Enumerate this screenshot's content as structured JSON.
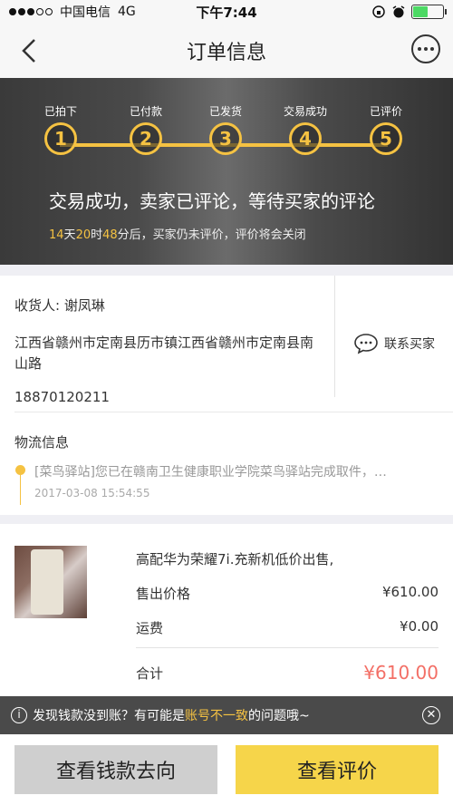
{
  "status_bar": {
    "carrier": "中国电信",
    "network": "4G",
    "time": "下午7:44",
    "battery_level": 0.5
  },
  "nav": {
    "title": "订单信息"
  },
  "progress": {
    "steps": [
      {
        "label": "已拍下",
        "num": "1"
      },
      {
        "label": "已付款",
        "num": "2"
      },
      {
        "label": "已发货",
        "num": "3"
      },
      {
        "label": "交易成功",
        "num": "4"
      },
      {
        "label": "已评价",
        "num": "5"
      }
    ],
    "status_title": "交易成功，卖家已评论，等待买家的评论",
    "countdown_days": "14",
    "countdown_days_unit": "天",
    "countdown_hours": "20",
    "countdown_hours_unit": "时",
    "countdown_minutes": "48",
    "countdown_suffix": "分后，买家仍未评价，评价将会关闭"
  },
  "address": {
    "receiver": "收货人: 谢凤琳",
    "detail": "江西省赣州市定南县历市镇江西省赣州市定南县南山路",
    "phone": "18870120211",
    "contact_label": "联系买家"
  },
  "logistics": {
    "title": "物流信息",
    "message": "[菜鸟驿站]您已在赣南卫生健康职业学院菜鸟驿站完成取件，…",
    "time": "2017-03-08 15:54:55"
  },
  "product": {
    "title": "高配华为荣耀7i.充新机低价出售,",
    "price_label": "售出价格",
    "price_value": "¥610.00",
    "shipping_label": "运费",
    "shipping_value": "¥0.00",
    "total_label": "合计",
    "total_value": "¥610.00"
  },
  "notice": {
    "prefix": "发现钱款没到账？有可能是",
    "highlight": "账号不一致",
    "suffix": "的问题哦~"
  },
  "actions": {
    "left_label": "查看钱款去向",
    "right_label": "查看评价"
  },
  "colors": {
    "accent": "#f5c242",
    "price_red": "#f36f66",
    "button_yellow": "#f6d54a"
  }
}
